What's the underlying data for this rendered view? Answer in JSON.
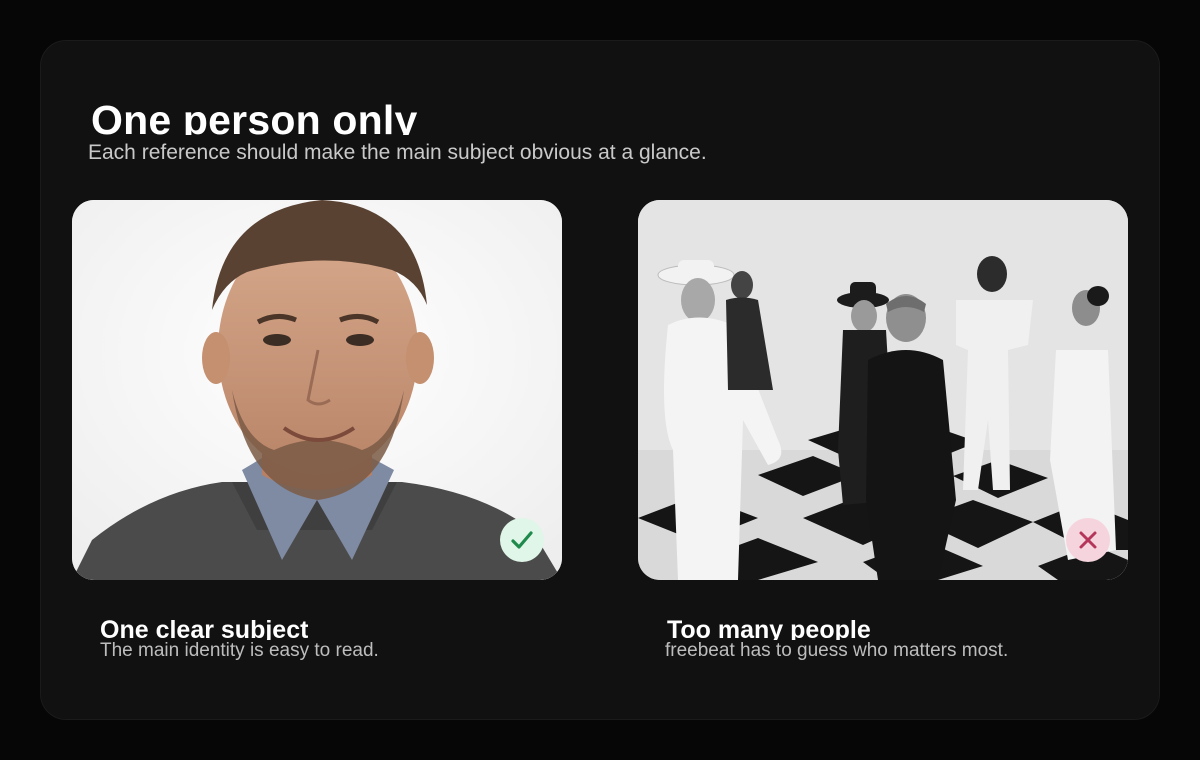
{
  "colors": {
    "background": "#060606",
    "card": "#111111",
    "good_badge": "#dff6e8",
    "good_check": "#1f8a4c",
    "bad_badge": "#f6d4de",
    "bad_x": "#b4375b"
  },
  "header": {
    "title": "One person only",
    "subtitle": "Each reference should make the main subject obvious at a glance."
  },
  "examples": [
    {
      "caption_title": "One clear subject",
      "caption_text": "The main identity is easy to read.",
      "badge_icon": "check-icon"
    },
    {
      "caption_title": "Too many people",
      "caption_text": "freebeat has to guess who matters most.",
      "badge_icon": "close-icon"
    }
  ]
}
